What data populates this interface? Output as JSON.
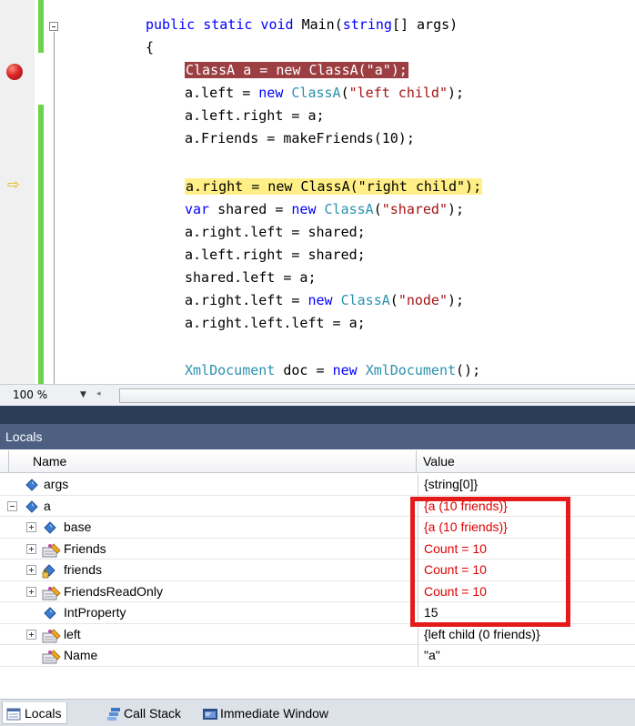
{
  "editor": {
    "lines": [
      [
        {
          "t": "public static void ",
          "c": "kw-mixed"
        }
      ],
      []
    ],
    "code": [
      {
        "parts": [
          [
            "kw",
            "public"
          ],
          [
            "",
            "  "
          ],
          [
            "kw",
            "static"
          ],
          [
            "",
            ""
          ]
        ]
      }
    ]
  },
  "code_lines": [
    {
      "segments": [
        {
          "k": "kw",
          "t": "public static void"
        },
        {
          "k": "",
          "t": " Main("
        },
        {
          "k": "kw",
          "t": "string"
        },
        {
          "k": "",
          "t": "[] args)"
        }
      ]
    },
    {
      "segments": [
        {
          "k": "",
          "t": "{"
        }
      ]
    },
    {
      "segments": [
        {
          "k": "bp",
          "t": "ClassA a = new ClassA(\"a\");"
        }
      ]
    },
    {
      "segments": [
        {
          "k": "",
          "t": "a.left = "
        },
        {
          "k": "kw",
          "t": "new"
        },
        {
          "k": "",
          "t": " "
        },
        {
          "k": "ty",
          "t": "ClassA"
        },
        {
          "k": "",
          "t": "("
        },
        {
          "k": "st",
          "t": "\"left child\""
        },
        {
          "k": "",
          "t": ");"
        }
      ]
    },
    {
      "segments": [
        {
          "k": "",
          "t": "a.left.right = a;"
        }
      ]
    },
    {
      "segments": [
        {
          "k": "",
          "t": "a.Friends = makeFriends(10);"
        }
      ]
    },
    {
      "segments": []
    },
    {
      "segments": [
        {
          "k": "cur",
          "t": "a.right = new ClassA(\"right child\");"
        }
      ]
    },
    {
      "segments": [
        {
          "k": "kw",
          "t": "var"
        },
        {
          "k": "",
          "t": " shared = "
        },
        {
          "k": "kw",
          "t": "new"
        },
        {
          "k": "",
          "t": " "
        },
        {
          "k": "ty",
          "t": "ClassA"
        },
        {
          "k": "",
          "t": "("
        },
        {
          "k": "st",
          "t": "\"shared\""
        },
        {
          "k": "",
          "t": ");"
        }
      ]
    },
    {
      "segments": [
        {
          "k": "",
          "t": "a.right.left = shared;"
        }
      ]
    },
    {
      "segments": [
        {
          "k": "",
          "t": "a.left.right = shared;"
        }
      ]
    },
    {
      "segments": [
        {
          "k": "",
          "t": "shared.left = a;"
        }
      ]
    },
    {
      "segments": [
        {
          "k": "",
          "t": "a.right.left = "
        },
        {
          "k": "kw",
          "t": "new"
        },
        {
          "k": "",
          "t": " "
        },
        {
          "k": "ty",
          "t": "ClassA"
        },
        {
          "k": "",
          "t": "("
        },
        {
          "k": "st",
          "t": "\"node\""
        },
        {
          "k": "",
          "t": ");"
        }
      ]
    },
    {
      "segments": [
        {
          "k": "",
          "t": "a.right.left.left = a;"
        }
      ]
    },
    {
      "segments": []
    },
    {
      "segments": [
        {
          "k": "ty",
          "t": "XmlDocument"
        },
        {
          "k": "",
          "t": " doc = "
        },
        {
          "k": "kw",
          "t": "new"
        },
        {
          "k": "",
          "t": " "
        },
        {
          "k": "ty",
          "t": "XmlDocument"
        },
        {
          "k": "",
          "t": "();"
        }
      ]
    }
  ],
  "zoom": {
    "value": "100 %"
  },
  "locals": {
    "title": "Locals",
    "col_name": "Name",
    "col_value": "Value",
    "rows": [
      {
        "name": "args",
        "value": "{string[0]}",
        "icon": "field-icon",
        "expander": "none",
        "indent": 0,
        "changed": false
      },
      {
        "name": "a",
        "value": "{a (10 friends)}",
        "icon": "field-icon",
        "expander": "minus",
        "indent": 0,
        "changed": true
      },
      {
        "name": "base",
        "value": "{a (10 friends)}",
        "icon": "field-icon",
        "expander": "plus",
        "indent": 1,
        "changed": true
      },
      {
        "name": "Friends",
        "value": "Count = 10",
        "icon": "property-icon",
        "expander": "plus",
        "indent": 1,
        "changed": true
      },
      {
        "name": "friends",
        "value": "Count = 10",
        "icon": "private-field-icon",
        "expander": "plus",
        "indent": 1,
        "changed": true
      },
      {
        "name": "FriendsReadOnly",
        "value": "Count = 10",
        "icon": "property-icon",
        "expander": "plus",
        "indent": 1,
        "changed": true
      },
      {
        "name": "IntProperty",
        "value": "15",
        "icon": "field-icon",
        "expander": "none",
        "indent": 1,
        "changed": false
      },
      {
        "name": "left",
        "value": "{left child (0 friends)}",
        "icon": "property-icon",
        "expander": "plus",
        "indent": 1,
        "changed": false
      },
      {
        "name": "Name",
        "value": "\"a\"",
        "icon": "property-icon",
        "expander": "none",
        "indent": 1,
        "changed": false
      }
    ]
  },
  "tabs": [
    {
      "label": "Locals",
      "icon": "locals-icon",
      "active": true
    },
    {
      "label": "Call Stack",
      "icon": "call-stack-icon",
      "active": false
    },
    {
      "label": "Immediate Window",
      "icon": "immediate-window-icon",
      "active": false
    }
  ],
  "colors": {
    "breakpoint_highlight": "#9c3f43",
    "current_line_highlight": "#ffef86",
    "changed_value": "#e00000",
    "callout_box": "#e51b1b",
    "keyword": "#0000ff",
    "type": "#2b91af",
    "string": "#a31515"
  }
}
